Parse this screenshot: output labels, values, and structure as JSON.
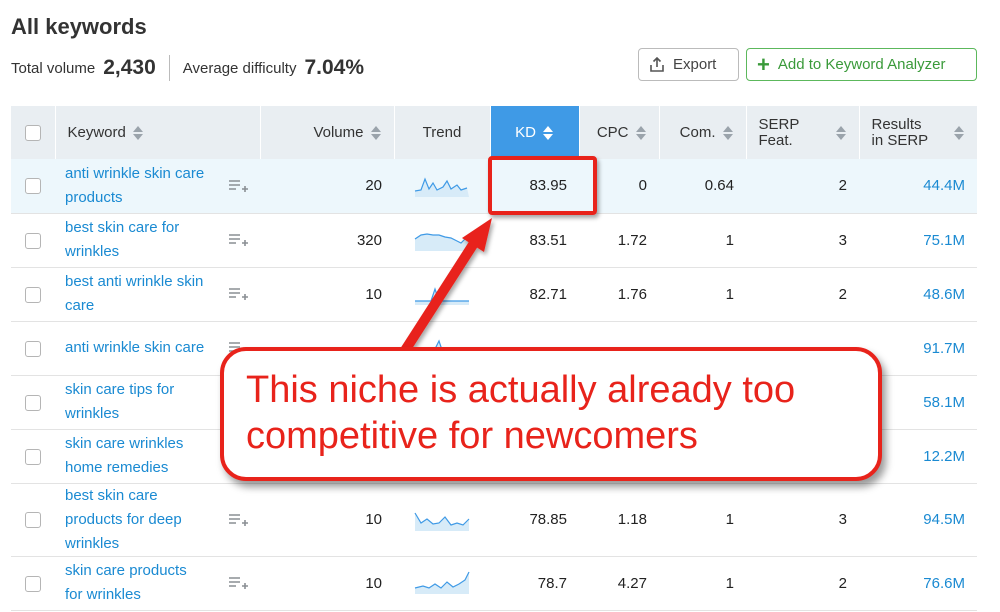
{
  "header": {
    "title": "All keywords",
    "total_volume_label": "Total volume",
    "total_volume": "2,430",
    "avg_difficulty_label": "Average difficulty",
    "avg_difficulty": "7.04%"
  },
  "toolbar": {
    "export_label": "Export",
    "add_label": "Add to Keyword Analyzer",
    "accent_color": "#5cb85c"
  },
  "table": {
    "columns": {
      "keyword": "Keyword",
      "volume": "Volume",
      "trend": "Trend",
      "kd": "KD",
      "cpc": "CPC",
      "com": "Com.",
      "serp_1": "SERP",
      "serp_2": "Feat.",
      "results_1": "Results",
      "results_2": "in SERP"
    },
    "sorted_column": "KD",
    "active_color": "#3f9ae6",
    "rows": [
      {
        "keyword": "anti wrinkle skin care products",
        "volume": "20",
        "kd": "83.95",
        "cpc": "0",
        "com": "0.64",
        "serp": "2",
        "results": "44.4M"
      },
      {
        "keyword": "best skin care for wrinkles",
        "volume": "320",
        "kd": "83.51",
        "cpc": "1.72",
        "com": "1",
        "serp": "3",
        "results": "75.1M"
      },
      {
        "keyword": "best anti wrinkle skin care",
        "volume": "10",
        "kd": "82.71",
        "cpc": "1.76",
        "com": "1",
        "serp": "2",
        "results": "48.6M"
      },
      {
        "keyword": "anti wrinkle skin care",
        "volume": "",
        "kd": "",
        "cpc": "",
        "com": "",
        "serp": "",
        "results": "91.7M"
      },
      {
        "keyword": "skin care tips for wrinkles",
        "volume": "",
        "kd": "",
        "cpc": "",
        "com": "",
        "serp": "",
        "results": "58.1M"
      },
      {
        "keyword": "skin care wrinkles home remedies",
        "volume": "",
        "kd": "",
        "cpc": "",
        "com": "",
        "serp": "",
        "results": "12.2M"
      },
      {
        "keyword": "best skin care products for deep wrinkles",
        "volume": "10",
        "kd": "78.85",
        "cpc": "1.18",
        "com": "1",
        "serp": "3",
        "results": "94.5M"
      },
      {
        "keyword": "skin care products for wrinkles",
        "volume": "10",
        "kd": "78.7",
        "cpc": "4.27",
        "com": "1",
        "serp": "2",
        "results": "76.6M"
      }
    ]
  },
  "annotation": {
    "text": "This niche is actually already too competitive for newcomers",
    "color": "#e8231b"
  }
}
